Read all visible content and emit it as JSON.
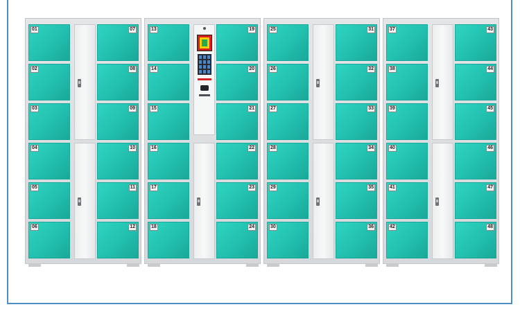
{
  "lockers": [
    {
      "left": [
        "01",
        "02",
        "03",
        "04",
        "05",
        "06"
      ],
      "right": [
        "07",
        "08",
        "09",
        "10",
        "11",
        "12"
      ],
      "center": "doors"
    },
    {
      "left": [
        "13",
        "14",
        "15",
        "16",
        "17",
        "18"
      ],
      "right": [
        "19",
        "20",
        "21",
        "22",
        "23",
        "24"
      ],
      "center": "terminal"
    },
    {
      "left": [
        "25",
        "26",
        "27",
        "28",
        "29",
        "30"
      ],
      "right": [
        "31",
        "32",
        "33",
        "34",
        "35",
        "36"
      ],
      "center": "doors"
    },
    {
      "left": [
        "37",
        "38",
        "39",
        "40",
        "41",
        "42"
      ],
      "right": [
        "43",
        "44",
        "45",
        "46",
        "47",
        "48"
      ],
      "center": "doors"
    }
  ],
  "colors": {
    "door": "#22bfae",
    "frame_border": "#4d8fc4",
    "cabinet": "#dcdfe1"
  },
  "icons": {
    "terminal": "control-terminal-icon",
    "handle": "door-handle-icon"
  }
}
